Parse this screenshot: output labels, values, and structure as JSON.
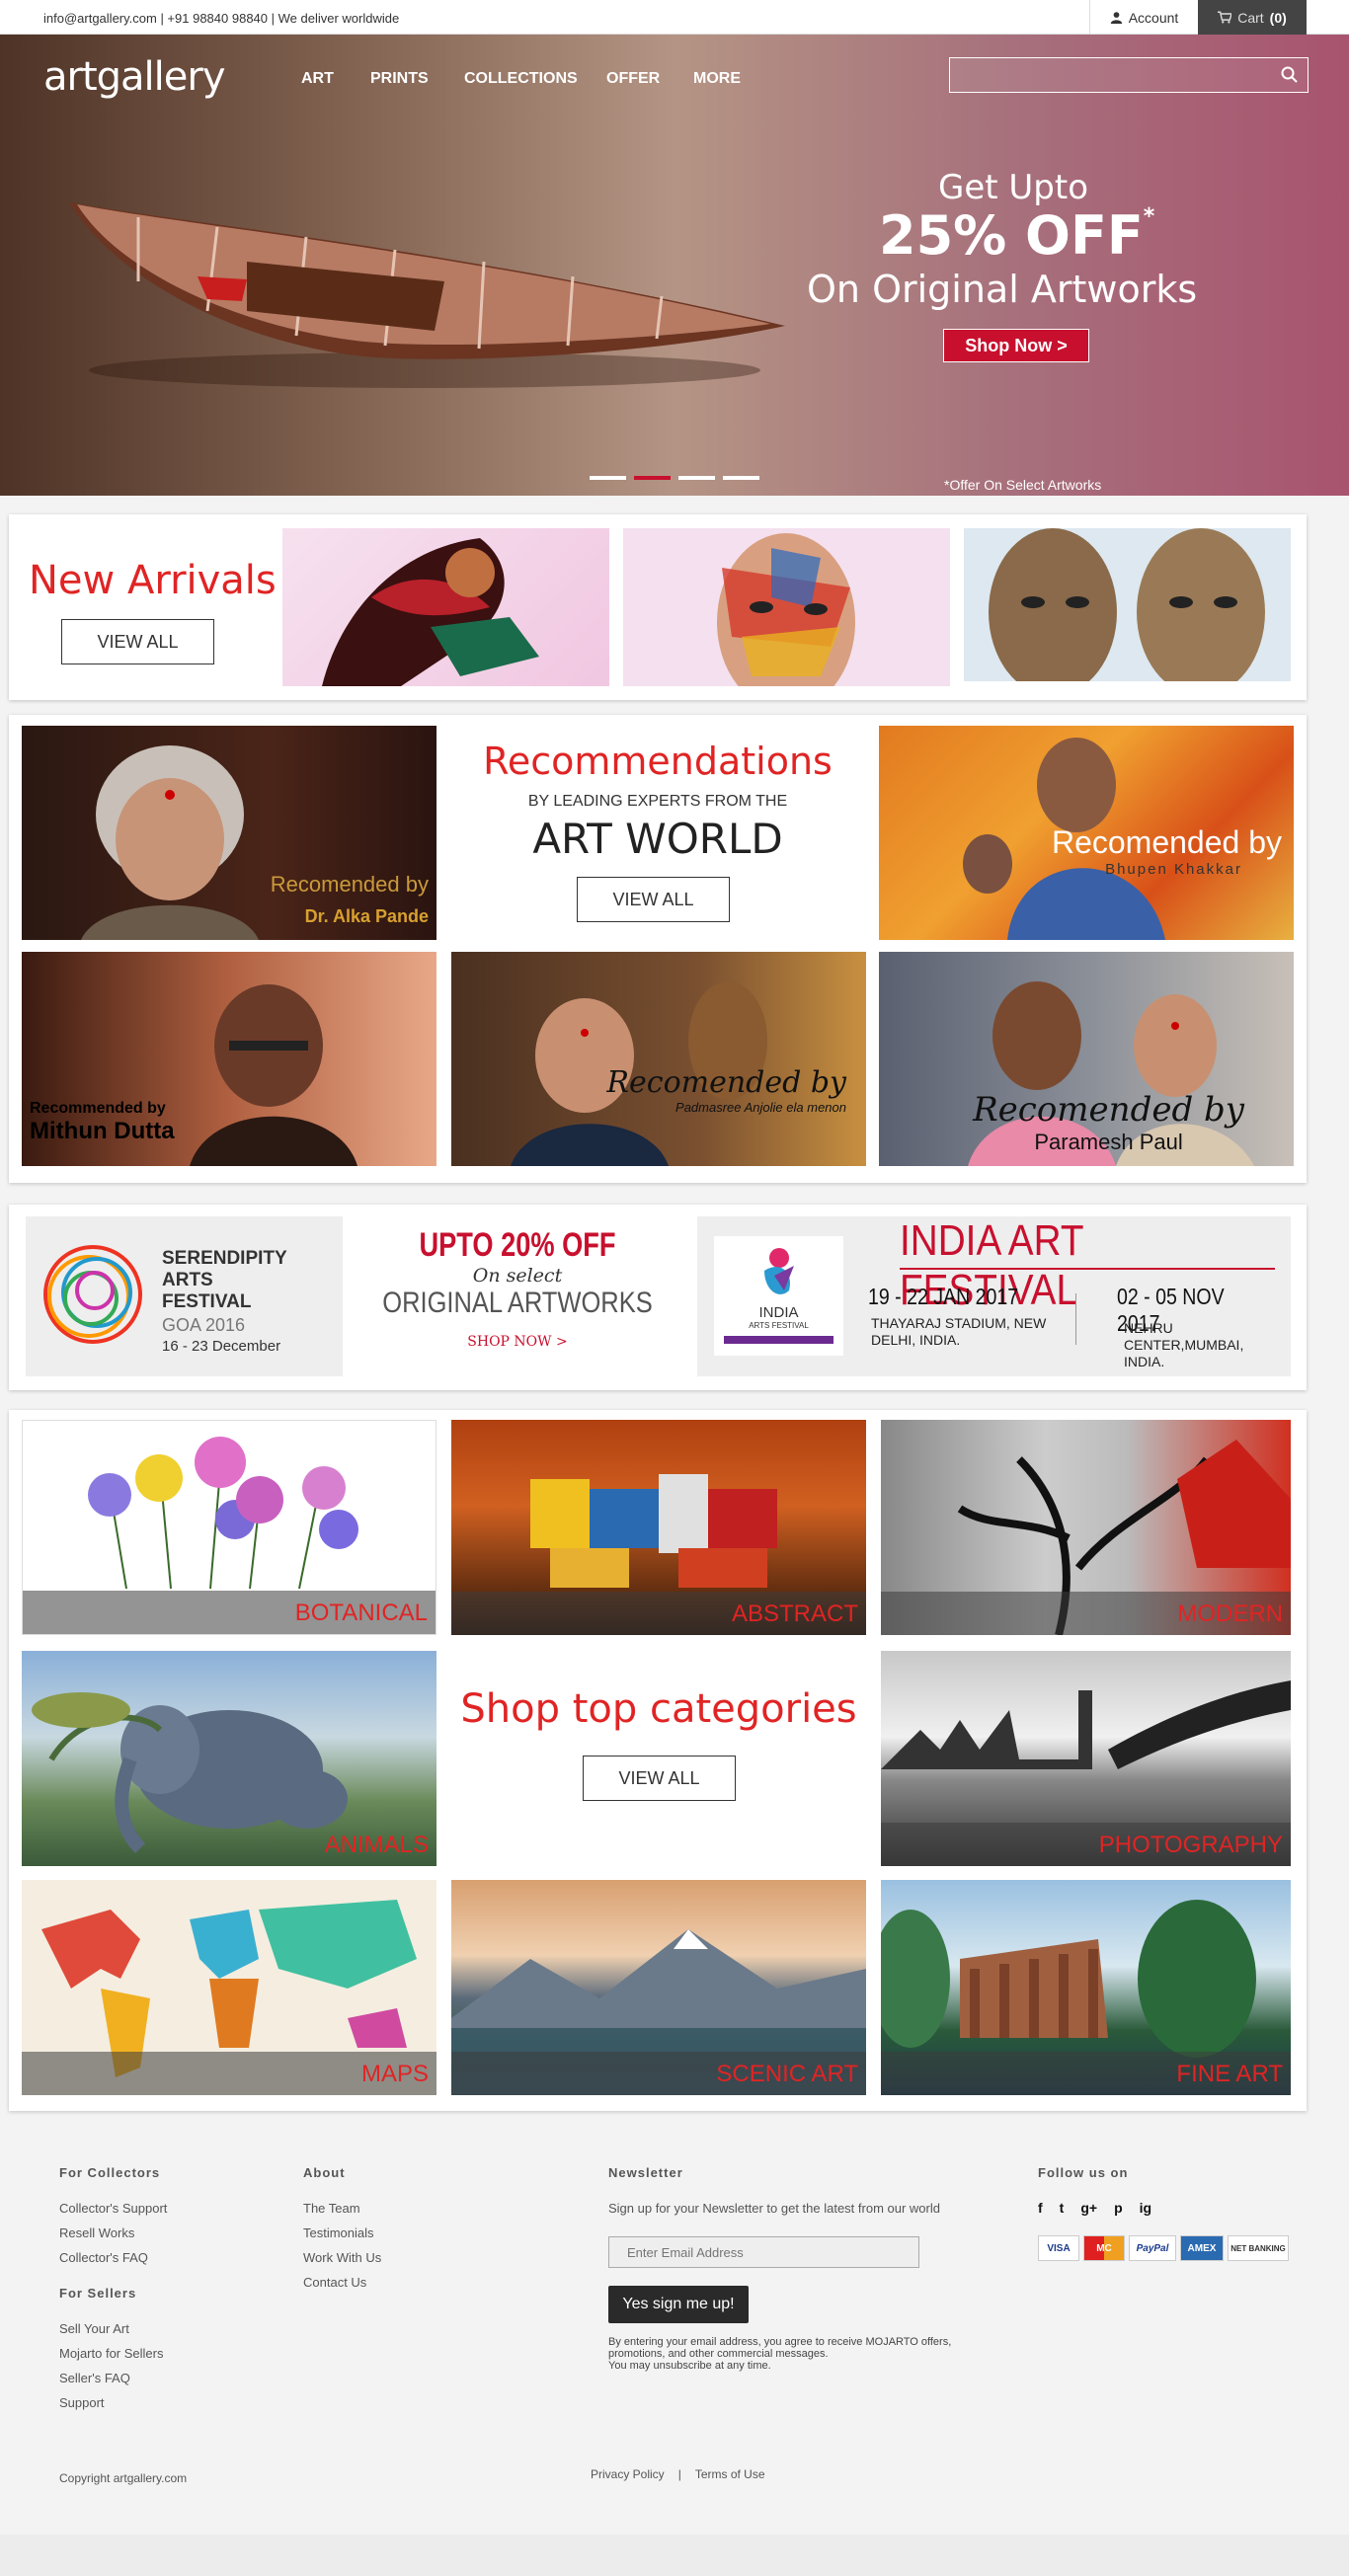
{
  "topbar": {
    "contact": "info@artgallery.com | +91 98840 98840 | We deliver worldwide",
    "account": "Account",
    "cart_label": "Cart",
    "cart_count": "(0)"
  },
  "header": {
    "logo": "artgallery",
    "nav": [
      "ART",
      "PRINTS",
      "COLLECTIONS",
      "OFFER",
      "MORE"
    ],
    "search_placeholder": ""
  },
  "hero": {
    "line1": "Get Upto",
    "line2": "25% OFF",
    "star": "*",
    "line3": "On Original Artworks",
    "cta": "Shop Now >",
    "note": "*Offer On Select Artworks",
    "slide_active": 2,
    "slide_count": 4
  },
  "new_arrivals": {
    "title": "New Arrivals",
    "button": "VIEW ALL"
  },
  "recommendations": {
    "title": "Recommendations",
    "sub": "BY LEADING EXPERTS FROM THE",
    "big": "ART WORLD",
    "button": "VIEW ALL",
    "tiles": [
      {
        "line1": "Recomended by",
        "line2": "Dr. Alka Pande"
      },
      {
        "line1": "Recomended by",
        "line2": "Bhupen Khakkar"
      },
      {
        "line1": "Recommended by",
        "line2": "Mithun Dutta"
      },
      {
        "line1": "Recomended by",
        "line2": "Padmasree Anjolie ela menon"
      },
      {
        "line1": "Recomended by",
        "line2": "Paramesh Paul"
      }
    ]
  },
  "festival": {
    "serendipity": {
      "l1": "SERENDIPITY",
      "l2": "ARTS",
      "l3": "FESTIVAL",
      "l4": "GOA 2016",
      "l5": "16 - 23 December"
    },
    "offer": {
      "l1": "UPTO 20% OFF",
      "l2": "On select",
      "l3": "ORIGINAL ARTWORKS",
      "cta": "SHOP NOW >"
    },
    "iaf": {
      "logo_l1": "INDIA",
      "logo_l2": "ARTS FESTIVAL",
      "title": "INDIA ART FESTIVAL",
      "date1": "19 - 22 JAN 2017",
      "venue1": "THAYARAJ STADIUM, NEW DELHI, INDIA.",
      "date2": "02 - 05 NOV 2017",
      "venue2": "NEHRU CENTER,MUMBAI, INDIA."
    }
  },
  "categories": {
    "title": "Shop top categories",
    "button": "VIEW ALL",
    "items": [
      "BOTANICAL",
      "ABSTRACT",
      "MODERN",
      "ANIMALS",
      "PHOTOGRAPHY",
      "MAPS",
      "SCENIC ART",
      "FINE ART"
    ]
  },
  "footer": {
    "collectors": {
      "title": "For Collectors",
      "links": [
        "Collector's Support",
        "Resell Works",
        "Collector's FAQ"
      ]
    },
    "sellers": {
      "title": "For Sellers",
      "links": [
        "Sell Your Art",
        "Mojarto for Sellers",
        "Seller's FAQ",
        "Support"
      ]
    },
    "about": {
      "title": "About",
      "links": [
        "The Team",
        "Testimonials",
        "Work With Us",
        "Contact Us"
      ]
    },
    "newsletter": {
      "title": "Newsletter",
      "text": "Sign up for your Newsletter to get the latest from our world",
      "placeholder": "Enter Email Address",
      "button": "Yes sign me up!",
      "disclaimer1": "By entering your email address, you agree to receive MOJARTO offers,",
      "disclaimer2": "promotions, and other commercial messages.",
      "disclaimer3": "You may unsubscribe at any time."
    },
    "follow": {
      "title": "Follow us on",
      "icons": [
        "f",
        "t",
        "g+",
        "p",
        "ig"
      ]
    },
    "payments": [
      "VISA",
      "MC",
      "PayPal",
      "AMEX",
      "NET BANKING"
    ],
    "copyright": "Copyright artgallery.com",
    "privacy": "Privacy Policy",
    "sep": "|",
    "terms": "Terms of Use"
  }
}
